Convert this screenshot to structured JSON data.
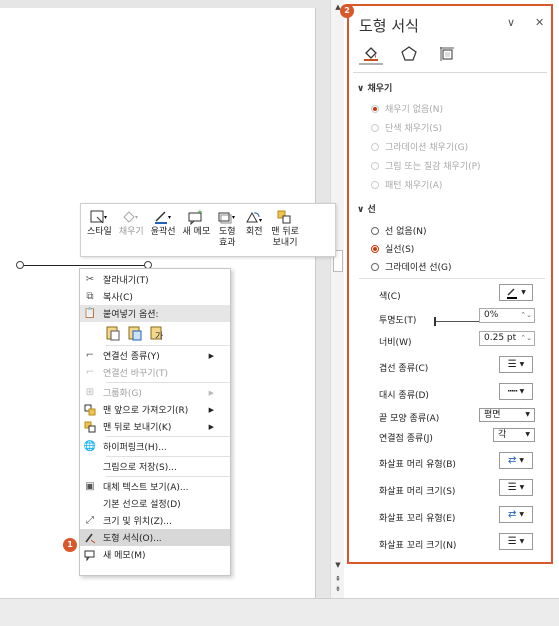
{
  "mini_toolbar": {
    "buttons": [
      {
        "label": "스타일",
        "icon": "style-icon",
        "disabled": false
      },
      {
        "label": "채우기",
        "icon": "fill-icon",
        "disabled": true
      },
      {
        "label": "윤곽선",
        "icon": "outline-icon",
        "disabled": false
      },
      {
        "label": "새 메모",
        "icon": "new-comment-icon",
        "disabled": false
      },
      {
        "label": "도형\n효과",
        "icon": "shape-effects-icon",
        "disabled": false
      },
      {
        "label": "회전",
        "icon": "rotate-icon",
        "disabled": false
      },
      {
        "label": "맨 뒤로\n보내기",
        "icon": "send-to-back-icon",
        "disabled": false
      }
    ]
  },
  "context_menu": {
    "cut": "잘라내기(T)",
    "copy": "복사(C)",
    "paste_options": "붙여넣기 옵션:",
    "paste_icons": [
      "paste-keep-source-icon",
      "paste-picture-icon",
      "paste-text-only-icon"
    ],
    "connector_type": "연결선 종류(Y)",
    "reroute_connectors": "연결선 바꾸기(T)",
    "group": "그룹화(G)",
    "bring_to_front": "맨 앞으로 가져오기(R)",
    "send_to_back": "맨 뒤로 보내기(K)",
    "hyperlink": "하이퍼링크(H)...",
    "save_as_picture": "그림으로 저장(S)...",
    "alt_text": "대체 텍스트 보기(A)...",
    "set_default_line": "기본 선으로 설정(D)",
    "size_position": "크기 및 위치(Z)...",
    "format_shape": "도형 서식(O)...",
    "new_comment": "새 메모(M)"
  },
  "badges": {
    "context": "1",
    "pane": "2"
  },
  "pane": {
    "title": "도형 서식",
    "fill_section": "채우기",
    "fill_options": [
      "채우기 없음(N)",
      "단색 채우기(S)",
      "그라데이션 채우기(G)",
      "그림 또는 질감 채우기(P)",
      "패턴 채우기(A)"
    ],
    "line_section": "선",
    "line_options": [
      "선 없음(N)",
      "실선(S)",
      "그라데이션 선(G)"
    ],
    "line_selected": 1,
    "props": {
      "color": "색(C)",
      "transparency": "투명도(T)",
      "transparency_value": "0%",
      "width": "너비(W)",
      "width_value": "0.25 pt",
      "compound_type": "겹선 종류(C)",
      "dash_type": "대시 종류(D)",
      "cap_type": "끝 모양 종류(A)",
      "cap_value": "평면",
      "join_type": "연결점 종류(J)",
      "join_value": "각",
      "begin_arrow_type": "화살표 머리 유형(B)",
      "begin_arrow_size": "화살표 머리 크기(S)",
      "end_arrow_type": "화살표 꼬리 유형(E)",
      "end_arrow_size": "화살표 꼬리 크기(N)"
    }
  },
  "colors": {
    "accent": "#d9582b",
    "radio_selected": "#c43d10"
  }
}
